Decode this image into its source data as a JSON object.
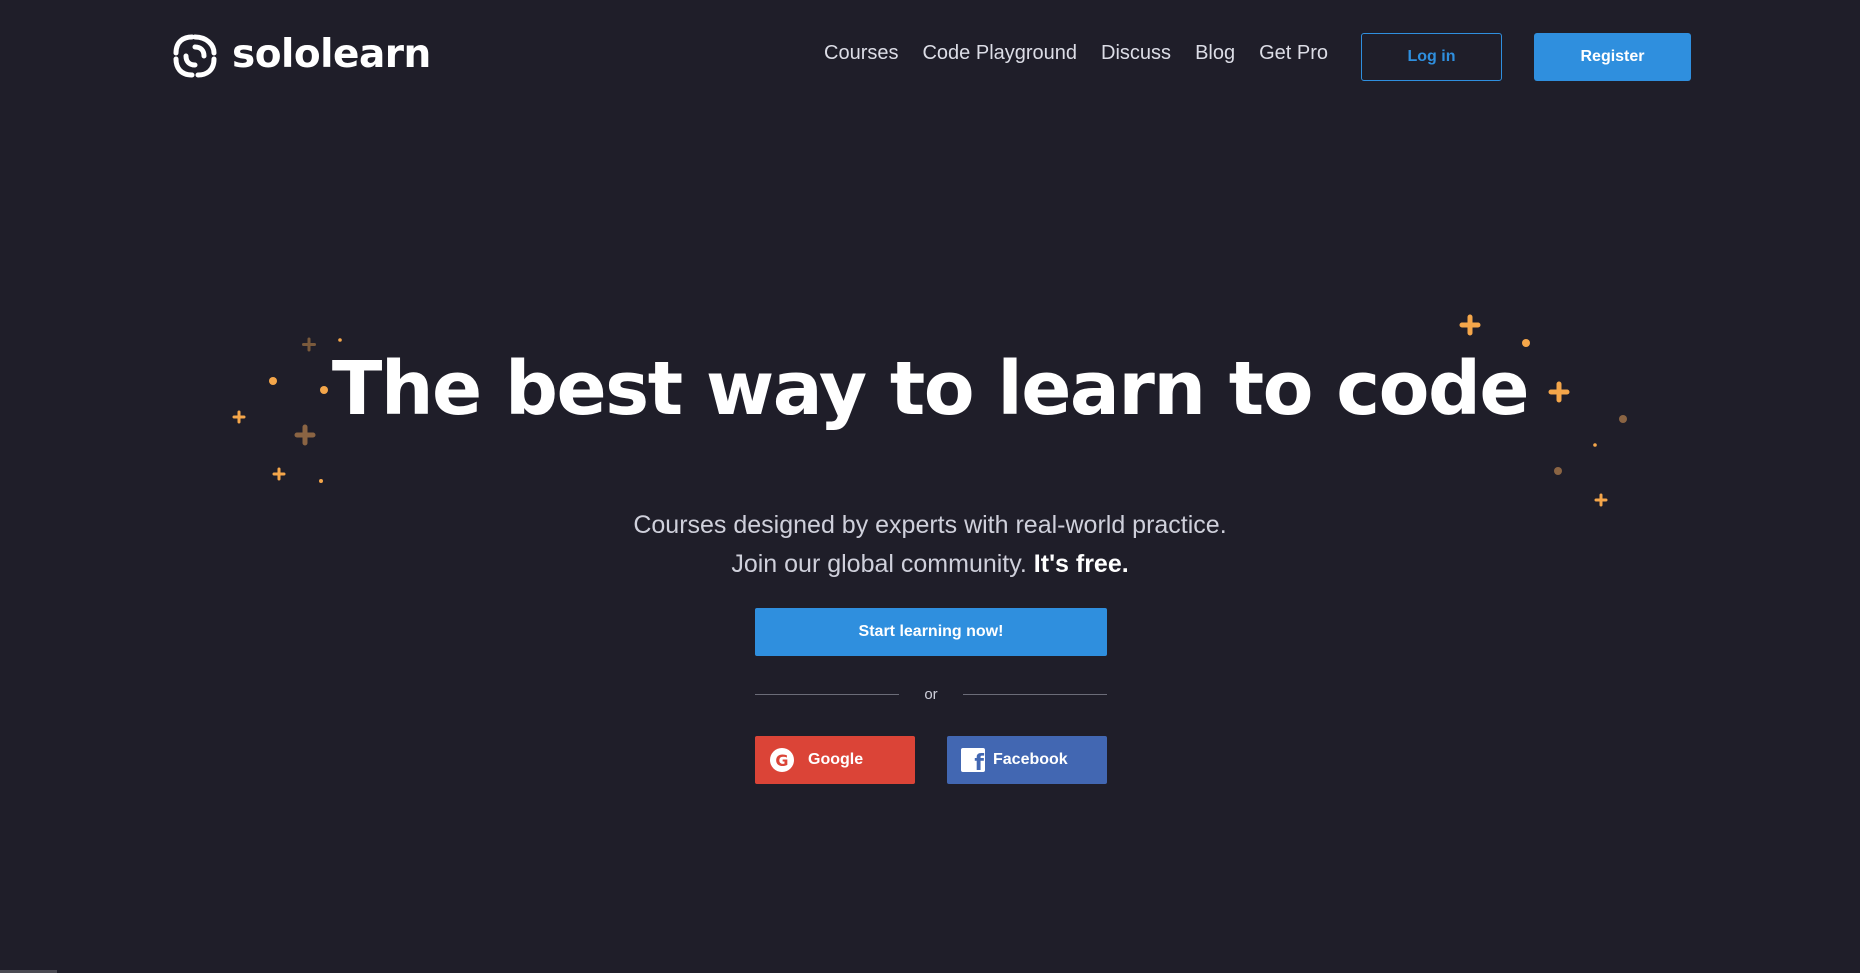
{
  "brand": {
    "name": "sololearn",
    "logo_icon": "sololearn-swirl-icon"
  },
  "nav": {
    "items": [
      {
        "label": "Courses"
      },
      {
        "label": "Code Playground"
      },
      {
        "label": "Discuss"
      },
      {
        "label": "Blog"
      },
      {
        "label": "Get Pro"
      }
    ],
    "login_label": "Log in",
    "register_label": "Register"
  },
  "hero": {
    "headline": "The best way to learn to code",
    "subtitle_line1": "Courses designed by experts with real-world practice.",
    "subtitle_line2": "Join our global community.",
    "subtitle_emphasis": "It's free.",
    "cta_label": "Start learning now!",
    "divider_text": "or",
    "google_label": "Google",
    "google_icon": "google-g-icon",
    "facebook_label": "Facebook",
    "facebook_icon": "facebook-f-icon"
  },
  "colors": {
    "background": "#1f1e29",
    "accent_blue": "#2f8fde",
    "google_red": "#db4437",
    "facebook_blue": "#4267b2",
    "sparkle_orange": "#f4a64a",
    "sparkle_brown": "#7a5a3c"
  }
}
